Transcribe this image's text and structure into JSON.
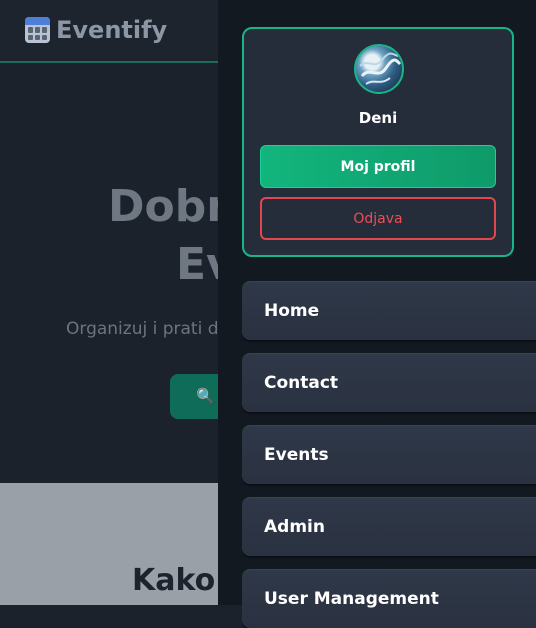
{
  "header": {
    "brand": "Eventify",
    "icon": "calendar-icon"
  },
  "hero": {
    "title_line1": "Dobr",
    "title_line2": "Ev",
    "subtitle": "Organizuj i prati d",
    "search_icon": "search-icon"
  },
  "section": {
    "title": "Kako v"
  },
  "drawer": {
    "username": "Deni",
    "profile_button": "Moj profil",
    "logout_button": "Odjava",
    "nav": [
      "Home",
      "Contact",
      "Events",
      "Admin",
      "User Management"
    ]
  },
  "colors": {
    "accent": "#19b586",
    "danger": "#ef4c55",
    "drawer_bg": "#131920",
    "card_bg": "#252d3a"
  }
}
